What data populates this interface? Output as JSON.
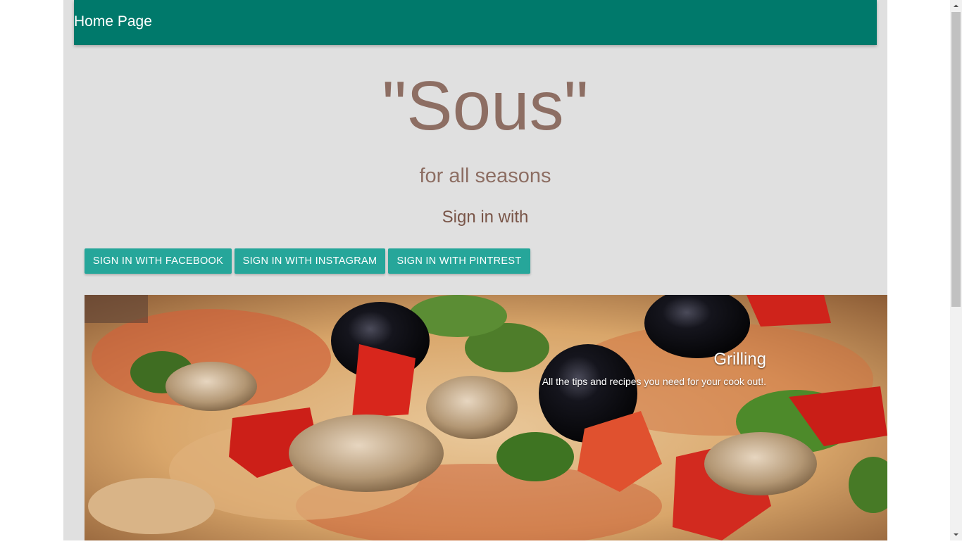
{
  "navbar": {
    "brand_label": "Home Page",
    "background_color": "#00796b"
  },
  "hero": {
    "title": "\"Sous\"",
    "subtitle": "for all seasons",
    "title_color": "#8d6e63"
  },
  "sign_in": {
    "heading": "Sign in with",
    "buttons": [
      {
        "label": "SIGN IN WITH FACEBOOK"
      },
      {
        "label": "SIGN IN WITH INSTAGRAM"
      },
      {
        "label": "SIGN IN WITH PINTREST"
      }
    ],
    "button_color": "#26a69a"
  },
  "carousel": {
    "slides": [
      {
        "image": "pizza-photo",
        "caption_title": "Grilling",
        "caption_text": "All the tips and recipes you need for your cook out!."
      }
    ]
  },
  "page": {
    "background_color": "#e0e0e0"
  }
}
